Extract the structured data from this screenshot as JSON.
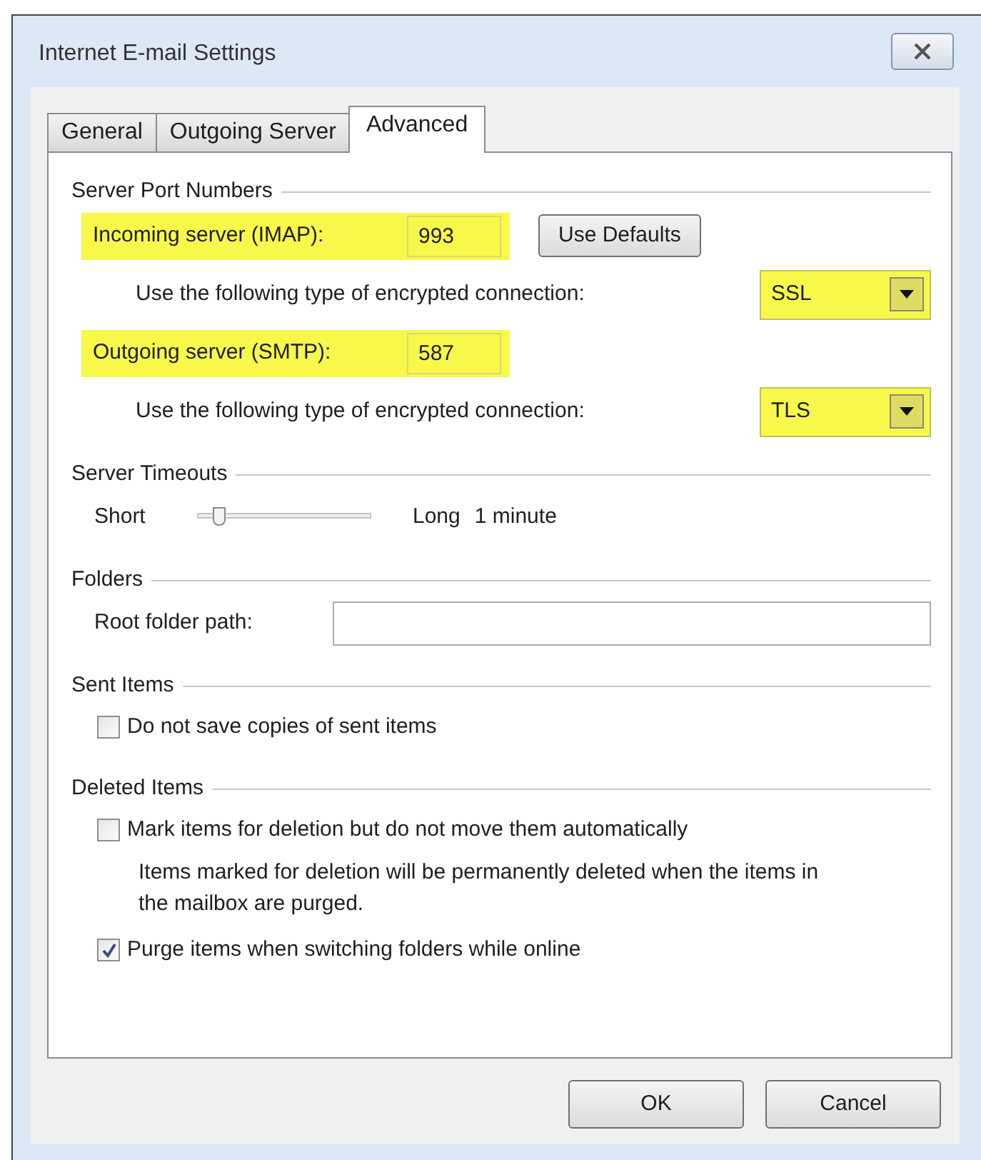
{
  "window": {
    "title": "Internet E-mail Settings"
  },
  "tabs": [
    {
      "label": "General",
      "selected": false
    },
    {
      "label": "Outgoing Server",
      "selected": false
    },
    {
      "label": "Advanced",
      "selected": true
    }
  ],
  "sections": [
    {
      "title": "Server Port Numbers",
      "rows": [
        {
          "kind": "port",
          "label": "Incoming server (IMAP):",
          "value": "993",
          "highlighted": true,
          "button": "Use Defaults"
        },
        {
          "kind": "select",
          "label": "Use the following type of encrypted connection:",
          "value": "SSL",
          "highlighted": true
        },
        {
          "kind": "port",
          "label": "Outgoing server (SMTP):",
          "value": "587",
          "highlighted": true
        },
        {
          "kind": "select",
          "label": "Use the following type of encrypted connection:",
          "value": "TLS",
          "highlighted": true
        }
      ]
    },
    {
      "title": "Server Timeouts",
      "rows": [
        {
          "kind": "slider",
          "min_label": "Short",
          "max_label": "Long",
          "level": 0.1,
          "reading": "1 minute"
        }
      ]
    },
    {
      "title": "Folders",
      "rows": [
        {
          "kind": "text",
          "label": "Root folder path:"
        }
      ]
    },
    {
      "title": "Sent Items",
      "rows": [
        {
          "kind": "checkbox",
          "label": "Do not save copies of sent items",
          "checked": false
        }
      ]
    },
    {
      "title": "Deleted Items",
      "rows": [
        {
          "kind": "checkbox",
          "label": "Mark items for deletion but do not move them automatically",
          "checked": false
        },
        {
          "kind": "note",
          "text": "Items marked for deletion will be permanently deleted when the items in the mailbox are purged."
        },
        {
          "kind": "checkbox",
          "label": "Purge items when switching folders while online",
          "checked": true
        }
      ]
    }
  ],
  "buttons": [
    "OK",
    "Cancel"
  ]
}
